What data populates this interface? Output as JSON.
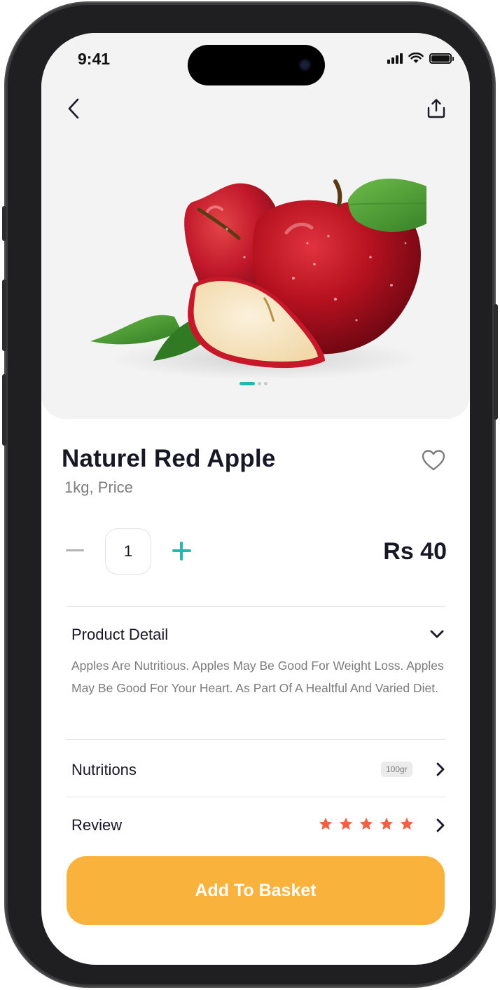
{
  "status_bar": {
    "time": "9:41"
  },
  "icons": {
    "back": "back-arrow-icon",
    "share": "share-icon",
    "favorite": "heart-outline-icon",
    "expand": "chevron-down-icon",
    "next": "chevron-right-icon",
    "star": "star-icon"
  },
  "product": {
    "name": "Naturel Red Apple",
    "subtitle": "1kg, Price",
    "quantity": "1",
    "price": "Rs 40",
    "image_count": 3,
    "active_image": 1
  },
  "detail": {
    "title": "Product Detail",
    "description": "Apples Are Nutritious. Apples May Be Good For Weight Loss. Apples May Be Good For Your Heart. As Part Of A Healtful And Varied Diet."
  },
  "nutritions": {
    "title": "Nutritions",
    "badge": "100gr"
  },
  "review": {
    "title": "Review",
    "rating": 5,
    "max": 5
  },
  "cta": {
    "label": "Add To Basket"
  },
  "colors": {
    "accent": "#22b8b3",
    "cta": "#f9b23c",
    "star": "#f3603f",
    "hero_bg": "#f2f3f2",
    "text_dark": "#181725",
    "text_muted": "#7c7c7c"
  }
}
